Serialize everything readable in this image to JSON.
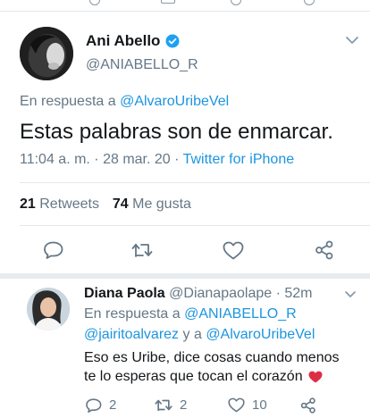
{
  "main_tweet": {
    "author_name": "Ani Abello",
    "author_handle": "@ANIABELLO_R",
    "reply_prefix": "En respuesta a",
    "reply_to": "@AlvaroUribeVel",
    "text": "Estas palabras son de enmarcar.",
    "time": "11:04 a. m. · 28 mar. 20 ·",
    "source": "Twitter for iPhone",
    "retweets_count": "21",
    "retweets_label": "Retweets",
    "likes_count": "74",
    "likes_label": "Me gusta"
  },
  "reply_tweet": {
    "author_name": "Diana Paola",
    "author_handle": "@Dianapaolape",
    "time": "· 52m",
    "reply_prefix": "En respuesta a",
    "reply_user_1": "@ANIABELLO_R",
    "reply_user_2": "@jairitoalvarez",
    "reply_joiner": "y a",
    "reply_user_3": "@AlvaroUribeVel",
    "text_line_1": "Eso es Uribe, dice cosas cuando menos",
    "text_line_2": "te lo esperas que tocan el corazón",
    "reply_count": "2",
    "retweet_count": "2",
    "like_count": "10"
  },
  "icons": {
    "verified": "verified-badge-icon",
    "chevron": "chevron-down-icon",
    "reply": "reply-icon",
    "retweet": "retweet-icon",
    "like": "heart-icon",
    "share": "share-icon",
    "emoji": "red-heart-emoji"
  },
  "colors": {
    "link": "#1b95e0",
    "secondary_text": "#657786",
    "heart": "#e0245e"
  }
}
